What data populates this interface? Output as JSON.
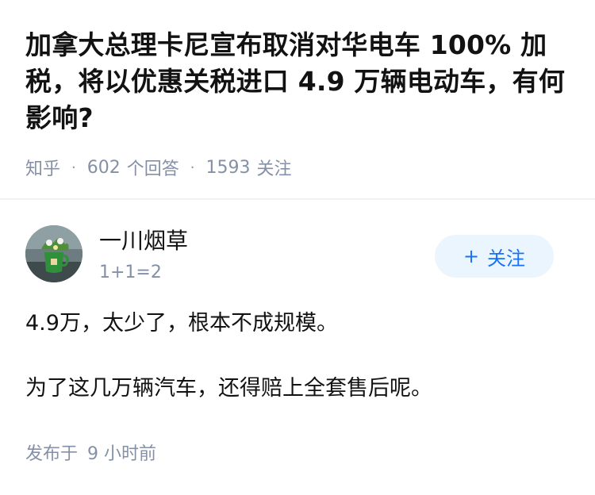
{
  "question": {
    "title": "加拿大总理卡尼宣布取消对华电车 100% 加税，将以优惠关税进口 4.9 万辆电动车，有何影响?",
    "source": "知乎",
    "answer_count": "602",
    "answer_label": "个回答",
    "follow_count": "1593",
    "follow_label": "关注"
  },
  "author": {
    "name": "一川烟草",
    "bio": "1+1=2",
    "follow_button": "关注",
    "follow_icon": "plus-icon"
  },
  "answer": {
    "paragraphs": [
      "4.9万，太少了，根本不成规模。",
      "为了这几万辆汽车，还得赔上全套售后呢。"
    ],
    "published_label": "发布于",
    "published_time": "9 小时前"
  },
  "colors": {
    "accent": "#1772f6",
    "meta_gray": "#8590a6",
    "follow_bg": "#ebf5fd"
  }
}
